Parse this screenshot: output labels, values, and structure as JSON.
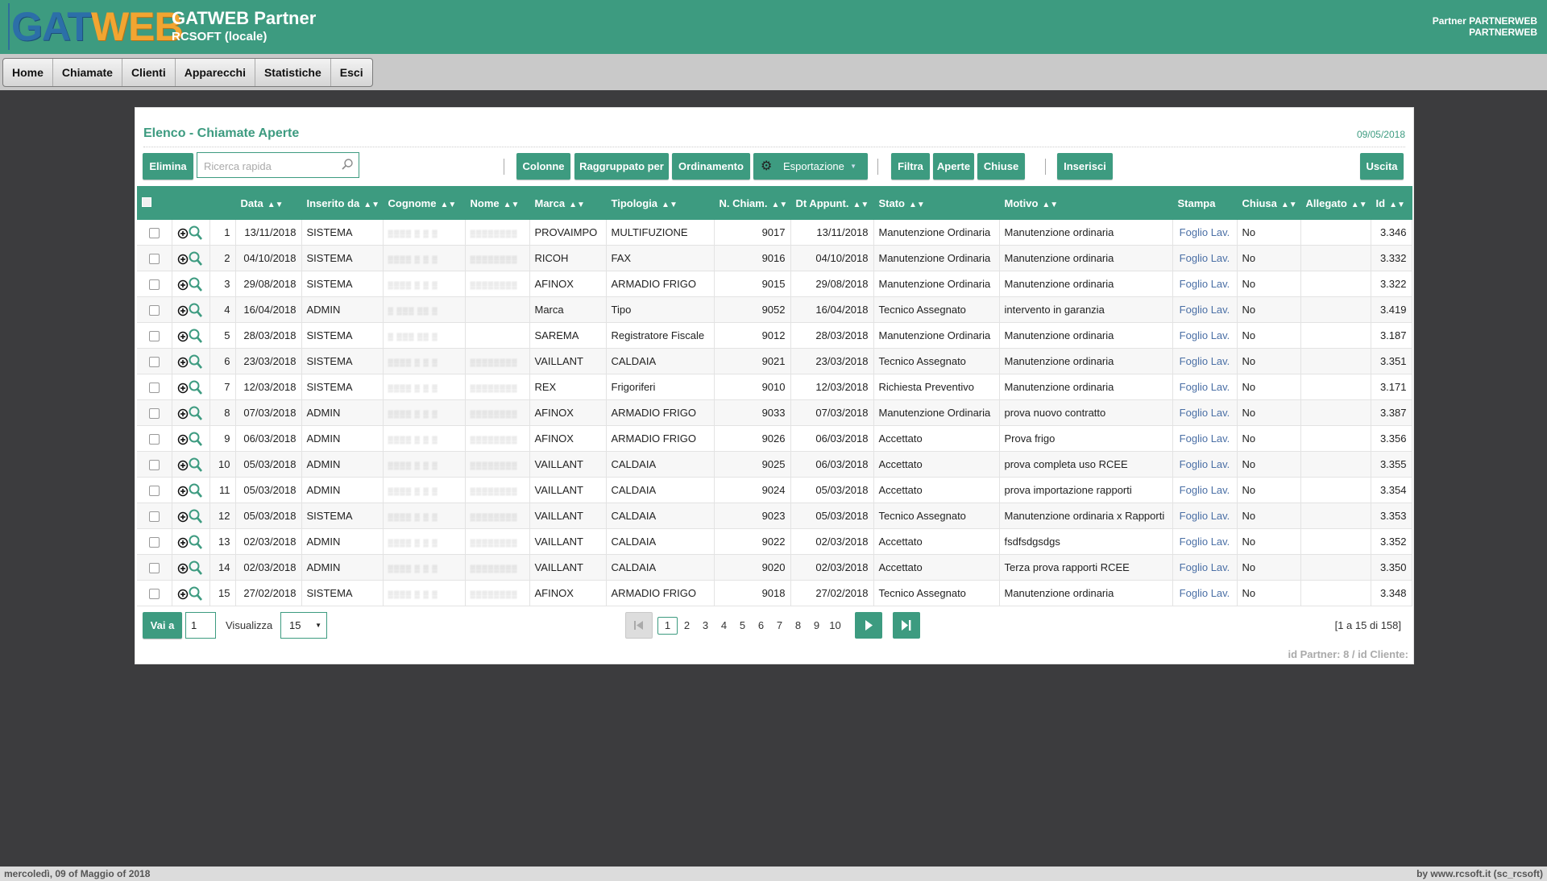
{
  "header": {
    "logo_part1": "GAT",
    "logo_part2": "WEB",
    "title": "GATWEB Partner",
    "subtitle": "RCSOFT (locale)",
    "partner_line1": "Partner PARTNERWEB",
    "partner_line2": "PARTNERWEB"
  },
  "menu": [
    "Home",
    "Chiamate",
    "Clienti",
    "Apparecchi",
    "Statistiche",
    "Esci"
  ],
  "panel": {
    "title": "Elenco - Chiamate Aperte",
    "date": "09/05/2018"
  },
  "toolbar": {
    "delete": "Elimina",
    "search_placeholder": "Ricerca rapida",
    "columns": "Colonne",
    "group_by": "Raggruppato per",
    "ordering": "Ordinamento",
    "export": "Esportazione",
    "filter": "Filtra",
    "open": "Aperte",
    "closed": "Chiuse",
    "insert": "Inserisci",
    "exit": "Uscita"
  },
  "columns": [
    "Data",
    "Inserito da",
    "Cognome",
    "Nome",
    "Marca",
    "Tipologia",
    "N. Chiam.",
    "Dt Appunt.",
    "Stato",
    "Motivo",
    "Stampa",
    "Chiusa",
    "Allegato",
    "Id"
  ],
  "rows": [
    {
      "n": "1",
      "data": "13/11/2018",
      "ins": "SISTEMA",
      "cog": "▒▒▒▒ ▒ ▒ ▒",
      "nom": "▒▒▒▒▒▒▒▒",
      "marca": "PROVAIMPO",
      "tip": "MULTIFUZIONE",
      "nch": "9017",
      "dt": "13/11/2018",
      "stato": "Manutenzione Ordinaria",
      "motivo": "Manutenzione ordinaria",
      "stampa": "Foglio Lav.",
      "chiusa": "No",
      "all": "",
      "id": "3.346"
    },
    {
      "n": "2",
      "data": "04/10/2018",
      "ins": "SISTEMA",
      "cog": "▒▒▒▒ ▒ ▒ ▒",
      "nom": "▒▒▒▒▒▒▒▒",
      "marca": "RICOH",
      "tip": "FAX",
      "nch": "9016",
      "dt": "04/10/2018",
      "stato": "Manutenzione Ordinaria",
      "motivo": "Manutenzione ordinaria",
      "stampa": "Foglio Lav.",
      "chiusa": "No",
      "all": "",
      "id": "3.332"
    },
    {
      "n": "3",
      "data": "29/08/2018",
      "ins": "SISTEMA",
      "cog": "▒▒▒▒ ▒ ▒ ▒",
      "nom": "▒▒▒▒▒▒▒▒",
      "marca": "AFINOX",
      "tip": "ARMADIO FRIGO",
      "nch": "9015",
      "dt": "29/08/2018",
      "stato": "Manutenzione Ordinaria",
      "motivo": "Manutenzione ordinaria",
      "stampa": "Foglio Lav.",
      "chiusa": "No",
      "all": "",
      "id": "3.322"
    },
    {
      "n": "4",
      "data": "16/04/2018",
      "ins": "ADMIN",
      "cog": "▒ ▒▒▒ ▒▒ ▒",
      "nom": "",
      "marca": "Marca",
      "tip": "Tipo",
      "nch": "9052",
      "dt": "16/04/2018",
      "stato": "Tecnico Assegnato",
      "motivo": "intervento in garanzia",
      "stampa": "Foglio Lav.",
      "chiusa": "No",
      "all": "",
      "id": "3.419"
    },
    {
      "n": "5",
      "data": "28/03/2018",
      "ins": "SISTEMA",
      "cog": "▒ ▒▒▒ ▒▒ ▒",
      "nom": "",
      "marca": "SAREMA",
      "tip": "Registratore Fiscale",
      "nch": "9012",
      "dt": "28/03/2018",
      "stato": "Manutenzione Ordinaria",
      "motivo": "Manutenzione ordinaria",
      "stampa": "Foglio Lav.",
      "chiusa": "No",
      "all": "",
      "id": "3.187"
    },
    {
      "n": "6",
      "data": "23/03/2018",
      "ins": "SISTEMA",
      "cog": "▒▒▒▒ ▒ ▒ ▒",
      "nom": "▒▒▒▒▒▒▒▒",
      "marca": "VAILLANT",
      "tip": "CALDAIA",
      "nch": "9021",
      "dt": "23/03/2018",
      "stato": "Tecnico Assegnato",
      "motivo": "Manutenzione ordinaria",
      "stampa": "Foglio Lav.",
      "chiusa": "No",
      "all": "",
      "id": "3.351"
    },
    {
      "n": "7",
      "data": "12/03/2018",
      "ins": "SISTEMA",
      "cog": "▒▒▒▒ ▒ ▒ ▒",
      "nom": "▒▒▒▒▒▒▒▒",
      "marca": "REX",
      "tip": "Frigoriferi",
      "nch": "9010",
      "dt": "12/03/2018",
      "stato": "Richiesta Preventivo",
      "motivo": "Manutenzione ordinaria",
      "stampa": "Foglio Lav.",
      "chiusa": "No",
      "all": "",
      "id": "3.171"
    },
    {
      "n": "8",
      "data": "07/03/2018",
      "ins": "ADMIN",
      "cog": "▒▒▒▒ ▒ ▒ ▒",
      "nom": "▒▒▒▒▒▒▒▒",
      "marca": "AFINOX",
      "tip": "ARMADIO FRIGO",
      "nch": "9033",
      "dt": "07/03/2018",
      "stato": "Manutenzione Ordinaria",
      "motivo": "prova nuovo contratto",
      "stampa": "Foglio Lav.",
      "chiusa": "No",
      "all": "",
      "id": "3.387"
    },
    {
      "n": "9",
      "data": "06/03/2018",
      "ins": "ADMIN",
      "cog": "▒▒▒▒ ▒ ▒ ▒",
      "nom": "▒▒▒▒▒▒▒▒",
      "marca": "AFINOX",
      "tip": "ARMADIO FRIGO",
      "nch": "9026",
      "dt": "06/03/2018",
      "stato": "Accettato",
      "motivo": "Prova frigo",
      "stampa": "Foglio Lav.",
      "chiusa": "No",
      "all": "",
      "id": "3.356"
    },
    {
      "n": "10",
      "data": "05/03/2018",
      "ins": "ADMIN",
      "cog": "▒▒▒▒ ▒ ▒ ▒",
      "nom": "▒▒▒▒▒▒▒▒",
      "marca": "VAILLANT",
      "tip": "CALDAIA",
      "nch": "9025",
      "dt": "06/03/2018",
      "stato": "Accettato",
      "motivo": "prova completa uso RCEE",
      "stampa": "Foglio Lav.",
      "chiusa": "No",
      "all": "",
      "id": "3.355"
    },
    {
      "n": "11",
      "data": "05/03/2018",
      "ins": "ADMIN",
      "cog": "▒▒▒▒ ▒ ▒ ▒",
      "nom": "▒▒▒▒▒▒▒▒",
      "marca": "VAILLANT",
      "tip": "CALDAIA",
      "nch": "9024",
      "dt": "05/03/2018",
      "stato": "Accettato",
      "motivo": "prova importazione rapporti",
      "stampa": "Foglio Lav.",
      "chiusa": "No",
      "all": "",
      "id": "3.354"
    },
    {
      "n": "12",
      "data": "05/03/2018",
      "ins": "SISTEMA",
      "cog": "▒▒▒▒ ▒ ▒ ▒",
      "nom": "▒▒▒▒▒▒▒▒",
      "marca": "VAILLANT",
      "tip": "CALDAIA",
      "nch": "9023",
      "dt": "05/03/2018",
      "stato": "Tecnico Assegnato",
      "motivo": "Manutenzione ordinaria x Rapporti",
      "stampa": "Foglio Lav.",
      "chiusa": "No",
      "all": "",
      "id": "3.353"
    },
    {
      "n": "13",
      "data": "02/03/2018",
      "ins": "ADMIN",
      "cog": "▒▒▒▒ ▒ ▒ ▒",
      "nom": "▒▒▒▒▒▒▒▒",
      "marca": "VAILLANT",
      "tip": "CALDAIA",
      "nch": "9022",
      "dt": "02/03/2018",
      "stato": "Accettato",
      "motivo": "fsdfsdgsdgs",
      "stampa": "Foglio Lav.",
      "chiusa": "No",
      "all": "",
      "id": "3.352"
    },
    {
      "n": "14",
      "data": "02/03/2018",
      "ins": "ADMIN",
      "cog": "▒▒▒▒ ▒ ▒ ▒",
      "nom": "▒▒▒▒▒▒▒▒",
      "marca": "VAILLANT",
      "tip": "CALDAIA",
      "nch": "9020",
      "dt": "02/03/2018",
      "stato": "Accettato",
      "motivo": "Terza prova rapporti RCEE",
      "stampa": "Foglio Lav.",
      "chiusa": "No",
      "all": "",
      "id": "3.350"
    },
    {
      "n": "15",
      "data": "27/02/2018",
      "ins": "SISTEMA",
      "cog": "▒▒▒▒ ▒ ▒ ▒",
      "nom": "▒▒▒▒▒▒▒▒",
      "marca": "AFINOX",
      "tip": "ARMADIO FRIGO",
      "nch": "9018",
      "dt": "27/02/2018",
      "stato": "Tecnico Assegnato",
      "motivo": "Manutenzione ordinaria",
      "stampa": "Foglio Lav.",
      "chiusa": "No",
      "all": "",
      "id": "3.348"
    }
  ],
  "pagination": {
    "goto_label": "Vai a",
    "goto_value": "1",
    "show_label": "Visualizza",
    "page_size": "15",
    "pages": [
      "1",
      "2",
      "3",
      "4",
      "5",
      "6",
      "7",
      "8",
      "9",
      "10"
    ],
    "current_page": "1",
    "range_text": "[1 a 15 di 158]"
  },
  "panel_footer": "id Partner: 8 / id Cliente:",
  "status_left": "mercoledì, 09 of Maggio of 2018",
  "status_right": "by www.rcsoft.it (sc_rcsoft)",
  "colors": {
    "accent": "#3d9b80",
    "background": "#3c3c3e",
    "link": "#4a6fa5"
  }
}
